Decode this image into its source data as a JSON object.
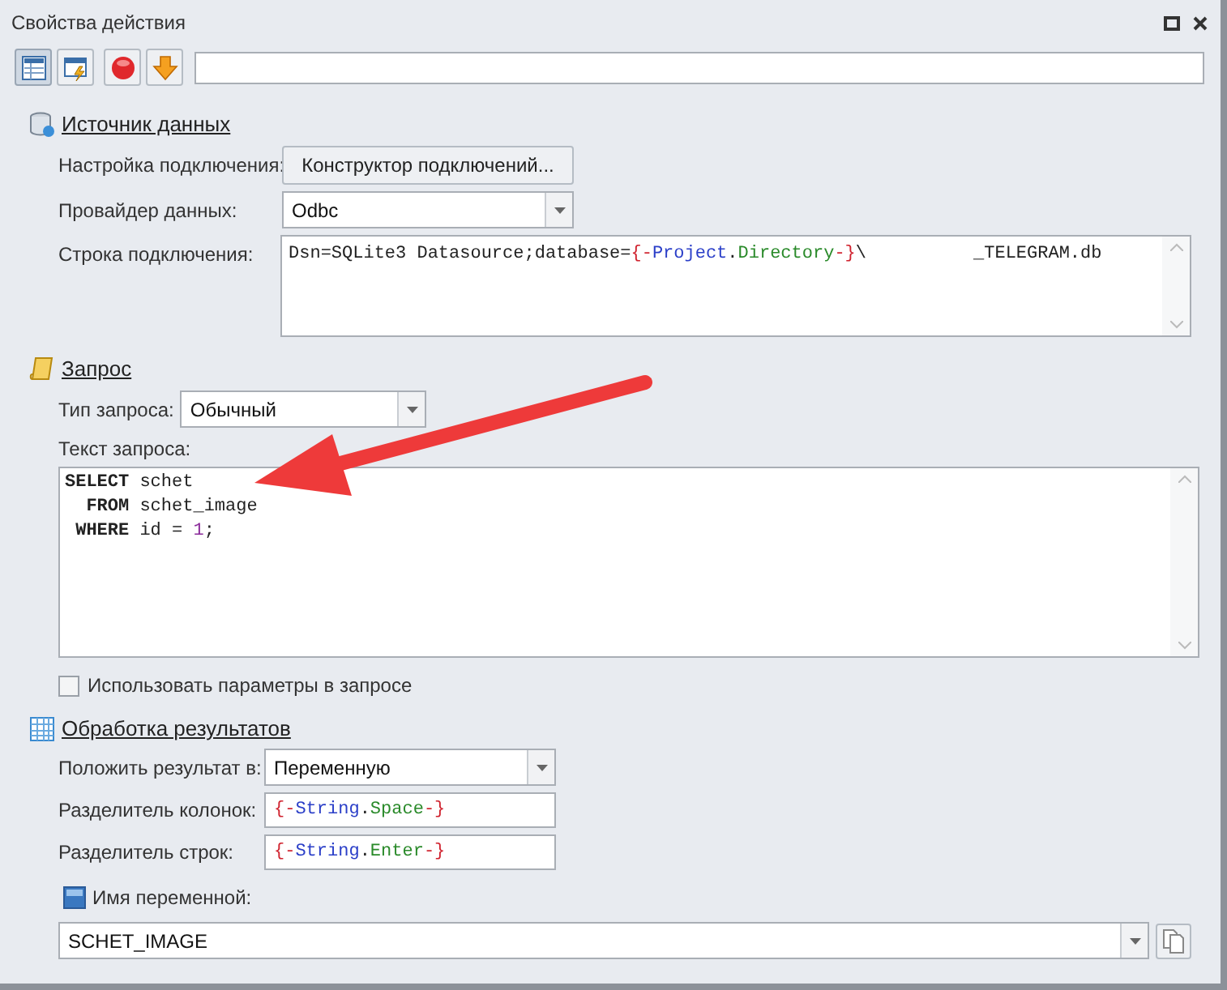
{
  "window": {
    "title": "Свойства действия"
  },
  "data_source": {
    "title": "Источник данных",
    "connection_setup": {
      "label": "Настройка подключения:",
      "button": "Конструктор подключений..."
    },
    "provider": {
      "label": "Провайдер данных:",
      "value": "Odbc"
    },
    "connection_string": {
      "label": "Строка подключения:",
      "segments": [
        {
          "text": "Dsn=SQLite3 Datasource;database=",
          "kind": "plain"
        },
        {
          "text": "{-",
          "kind": "brace"
        },
        {
          "text": "Project",
          "kind": "object"
        },
        {
          "text": ".",
          "kind": "plain"
        },
        {
          "text": "Directory",
          "kind": "property"
        },
        {
          "text": "-}",
          "kind": "brace"
        },
        {
          "text": "\\          _TELEGRAM.db",
          "kind": "plain"
        }
      ]
    }
  },
  "query": {
    "title": "Запрос",
    "type": {
      "label": "Тип запроса:",
      "value": "Обычный"
    },
    "text_label": "Текст запроса:",
    "lines": [
      [
        {
          "text": "SELECT",
          "kind": "keyword"
        },
        {
          "text": " schet",
          "kind": "plain"
        }
      ],
      [
        {
          "text": "  FROM",
          "kind": "keyword"
        },
        {
          "text": " schet_image",
          "kind": "plain"
        }
      ],
      [
        {
          "text": " WHERE",
          "kind": "keyword"
        },
        {
          "text": " id = ",
          "kind": "plain"
        },
        {
          "text": "1",
          "kind": "number"
        },
        {
          "text": ";",
          "kind": "plain"
        }
      ]
    ],
    "use_params": {
      "label": "Использовать параметры в запросе",
      "checked": false
    }
  },
  "results": {
    "title": "Обработка результатов",
    "put_to": {
      "label": "Положить результат в:",
      "value": "Переменную"
    },
    "column_separator": {
      "label": "Разделитель колонок:",
      "segments": [
        {
          "text": "{-",
          "kind": "brace"
        },
        {
          "text": "String",
          "kind": "object"
        },
        {
          "text": ".",
          "kind": "plain"
        },
        {
          "text": "Space",
          "kind": "property"
        },
        {
          "text": "-}",
          "kind": "brace"
        }
      ]
    },
    "row_separator": {
      "label": "Разделитель строк:",
      "segments": [
        {
          "text": "{-",
          "kind": "brace"
        },
        {
          "text": "String",
          "kind": "object"
        },
        {
          "text": ".",
          "kind": "plain"
        },
        {
          "text": "Enter",
          "kind": "property"
        },
        {
          "text": "-}",
          "kind": "brace"
        }
      ]
    },
    "variable": {
      "label": "Имя переменной:",
      "value": "SCHET_IMAGE"
    }
  }
}
